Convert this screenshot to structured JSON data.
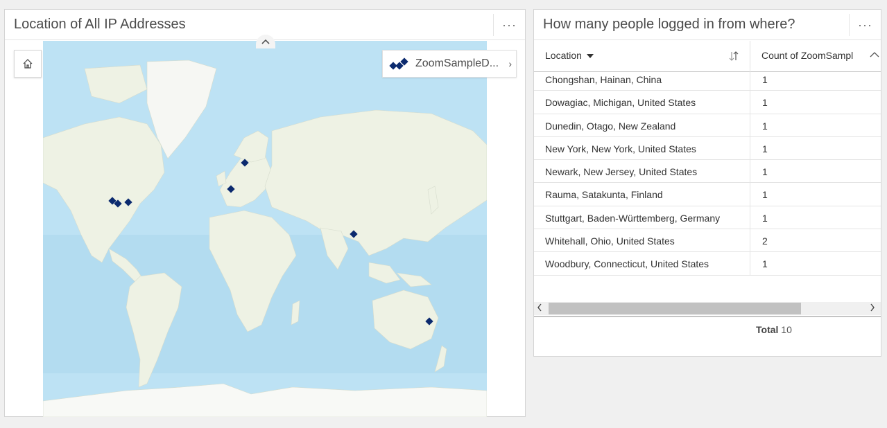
{
  "map_panel": {
    "title": "Location of All IP Addresses",
    "menu_label": "···",
    "legend_label": "ZoomSampleD...",
    "legend_chevron": "›",
    "marker_color": "#0b2a6e",
    "ocean_color": "#b9e0f3",
    "land_color": "#eef2e6"
  },
  "table_panel": {
    "title": "How many people logged in from where?",
    "menu_label": "···",
    "columns": {
      "location": "Location",
      "count": "Count of ZoomSampl"
    },
    "rows": [
      {
        "location": "Chongshan, Hainan, China",
        "count": "1"
      },
      {
        "location": "Dowagiac, Michigan, United States",
        "count": "1"
      },
      {
        "location": "Dunedin, Otago, New Zealand",
        "count": "1"
      },
      {
        "location": "New York, New York, United States",
        "count": "1"
      },
      {
        "location": "Newark, New Jersey, United States",
        "count": "1"
      },
      {
        "location": "Rauma, Satakunta, Finland",
        "count": "1"
      },
      {
        "location": "Stuttgart, Baden-Württemberg, Germany",
        "count": "1"
      },
      {
        "location": "Whitehall, Ohio, United States",
        "count": "2"
      },
      {
        "location": "Woodbury, Connecticut, United States",
        "count": "1"
      }
    ],
    "total_label": "Total",
    "total_value": "10"
  }
}
